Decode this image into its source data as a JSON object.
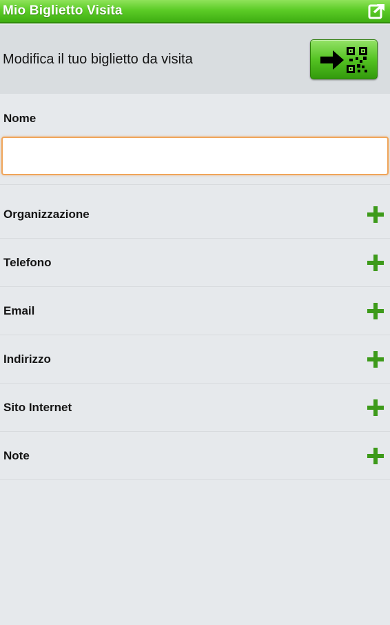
{
  "titlebar": {
    "app_title": "Mio Biglietto Visita",
    "share_icon": "share-export-icon",
    "color": "#5ccc27"
  },
  "header": {
    "title": "Modifica il tuo biglietto da visita",
    "qr_button_icon": "arrow-to-qr-icon"
  },
  "name_section": {
    "label": "Nome",
    "value": "",
    "placeholder": ""
  },
  "fields": [
    {
      "label": "Organizzazione",
      "icon": "plus-icon"
    },
    {
      "label": "Telefono",
      "icon": "plus-icon"
    },
    {
      "label": "Email",
      "icon": "plus-icon"
    },
    {
      "label": "Indirizzo",
      "icon": "plus-icon"
    },
    {
      "label": "Sito Internet",
      "icon": "plus-icon"
    },
    {
      "label": "Note",
      "icon": "plus-icon"
    }
  ],
  "colors": {
    "accent_green": "#3fae12",
    "input_focus": "#f0a55a",
    "background": "#e6e9ec"
  }
}
